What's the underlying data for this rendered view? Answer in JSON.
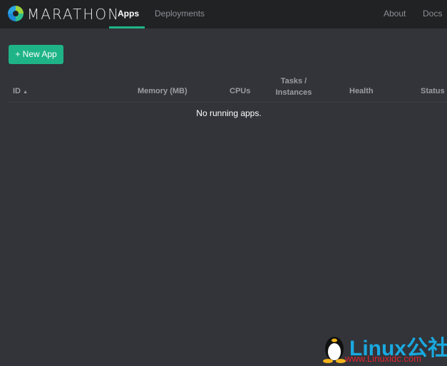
{
  "nav": {
    "brand": "MARATHON",
    "tabs": [
      {
        "label": "Apps",
        "active": true
      },
      {
        "label": "Deployments"
      }
    ],
    "right": [
      {
        "label": "About"
      },
      {
        "label": "Docs"
      }
    ]
  },
  "toolbar": {
    "new_app": "+ New App"
  },
  "table": {
    "columns": [
      "ID",
      "Memory (MB)",
      "CPUs",
      "Tasks /",
      "Instances",
      "Health",
      "Status"
    ],
    "sort_indicator": "▲",
    "empty": "No running apps."
  },
  "watermark": {
    "title": "Linux公社",
    "url": "www.Linuxidc.com"
  },
  "colors": {
    "accent": "#1fb487",
    "header": "#212224",
    "background": "#323439"
  }
}
